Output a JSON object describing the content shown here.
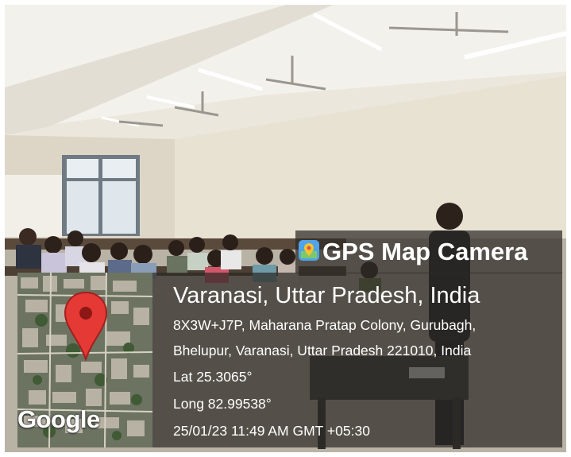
{
  "overlay": {
    "brand_icon": "gps-map-camera-icon",
    "brand_title": "GPS Map Camera",
    "place_title": "Varanasi, Uttar Pradesh, India",
    "address_line1": "8X3W+J7P, Maharana Pratap Colony, Gurubagh,",
    "address_line2": "Bhelupur, Varanasi, Uttar Pradesh 221010, India",
    "latitude": "Lat 25.3065°",
    "longitude": "Long 82.99538°",
    "timestamp": "25/01/23 11:49 AM GMT +05:30"
  },
  "map": {
    "logo_text": "Google",
    "pin_icon": "location-pin-icon",
    "pin_color": "#e53935"
  },
  "colors": {
    "overlay_bg": "#2d2926",
    "text": "#ffffff"
  }
}
